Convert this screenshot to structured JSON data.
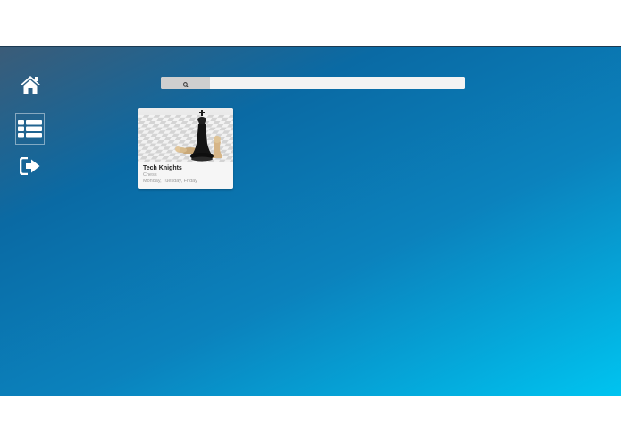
{
  "sidebar": {
    "items": [
      {
        "name": "home",
        "icon": "home-icon"
      },
      {
        "name": "list",
        "icon": "list-icon",
        "active": true
      },
      {
        "name": "logout",
        "icon": "sign-out-icon"
      }
    ]
  },
  "search": {
    "icon": "search-icon",
    "value": "",
    "placeholder": ""
  },
  "clubs": [
    {
      "title": "Tech Knights",
      "category": "Chess",
      "days": "Monday, Tuesday, Friday",
      "image": "chess-pieces-image"
    }
  ],
  "colors": {
    "gradient_start": "#3b5c78",
    "gradient_mid": "#0a6aa4",
    "gradient_end": "#00c4f0",
    "search_button": "#cfcfcf",
    "card_bg": "#f6f6f6"
  }
}
